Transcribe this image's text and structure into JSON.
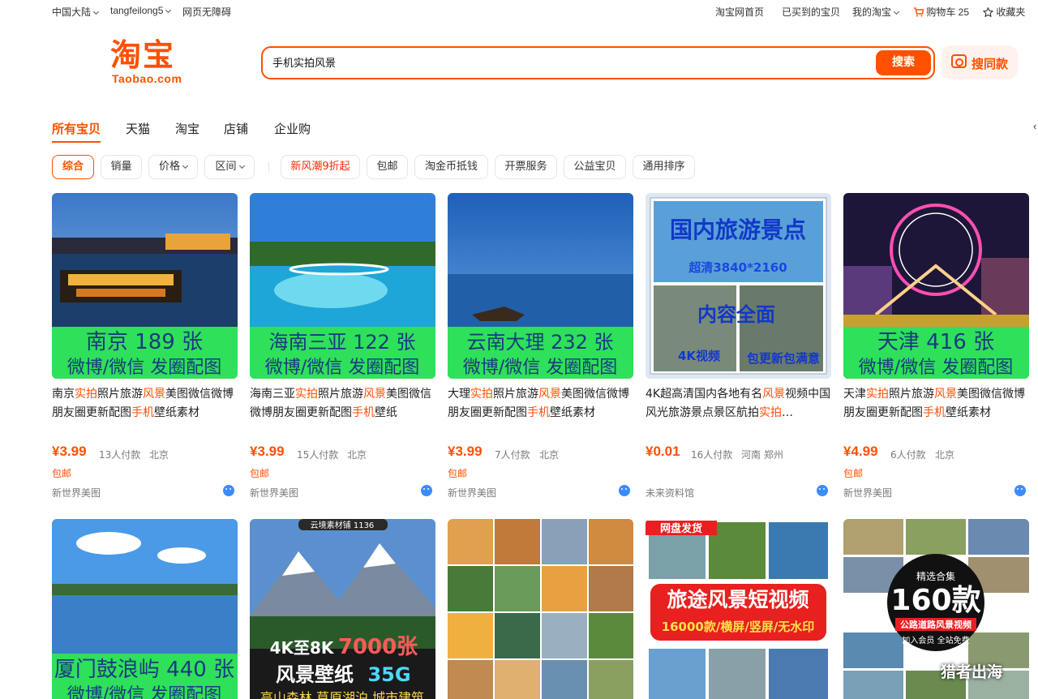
{
  "topbar": {
    "region": "中国大陆",
    "username": "tangfeilong5",
    "accessibility": "网页无障碍",
    "home": "淘宝网首页",
    "bought": "已买到的宝贝",
    "my_taobao": "我的淘宝",
    "cart": "购物车 25",
    "favorites": "收藏夹"
  },
  "logo": {
    "cn": "淘宝",
    "en": "Taobao.com"
  },
  "search": {
    "query": "手机实拍风景",
    "button": "搜索",
    "image_search": "搜同款"
  },
  "tabs": [
    "所有宝贝",
    "天猫",
    "淘宝",
    "店铺",
    "企业购"
  ],
  "filters": {
    "sort_default": "综合",
    "sales": "销量",
    "price": "价格",
    "range": "区间",
    "promo": "新风潮9折起",
    "free_shipping": "包邮",
    "coins": "淘金币抵钱",
    "invoice": "开票服务",
    "charity": "公益宝贝",
    "general_sort": "通用排序"
  },
  "products": [
    {
      "banner": [
        "南京 189 张",
        "微博/微信 发圈配图"
      ],
      "title_parts": [
        "南京",
        "实拍",
        "照片旅游",
        "风景",
        "美图微信微博朋友圈更新配图",
        "手机",
        "壁纸素材"
      ],
      "price": "¥3.99",
      "sales": "13人付款",
      "location": "北京",
      "shipping": "包邮",
      "shop": "新世界美图"
    },
    {
      "banner": [
        "海南三亚 122 张",
        "微博/微信 发圈配图"
      ],
      "title_parts": [
        "海南三亚",
        "实拍",
        "照片旅游",
        "风景",
        "美图微信微博朋友圈更新配图",
        "手机",
        "壁纸"
      ],
      "price": "¥3.99",
      "sales": "15人付款",
      "location": "北京",
      "shipping": "包邮",
      "shop": "新世界美图"
    },
    {
      "banner": [
        "云南大理 232 张",
        "微博/微信 发圈配图"
      ],
      "title_parts": [
        "大理",
        "实拍",
        "照片旅游",
        "风景",
        "美图微信微博朋友圈更新配图",
        "手机",
        "壁纸素材"
      ],
      "price": "¥3.99",
      "sales": "7人付款",
      "location": "北京",
      "shipping": "包邮",
      "shop": "新世界美图"
    },
    {
      "banner": [
        "国内旅游景点",
        "超清3840*2160",
        "内容全面",
        "4K视频",
        "包更新包满意"
      ],
      "title_parts": [
        "4K超高清国内各地有名",
        "风景",
        "视频中国风光旅游景点景区航拍",
        "实拍",
        "…",
        "",
        ""
      ],
      "price": "¥0.01",
      "sales": "16人付款",
      "location": "河南 郑州",
      "shipping": "",
      "shop": "未来资料馆"
    },
    {
      "banner": [
        "天津 416 张",
        "微博/微信 发圈配图"
      ],
      "title_parts": [
        "天津",
        "实拍",
        "照片旅游",
        "风景",
        "美图微信微博朋友圈更新配图",
        "手机",
        "壁纸素材"
      ],
      "price": "¥4.99",
      "sales": "6人付款",
      "location": "北京",
      "shipping": "包邮",
      "shop": "新世界美图"
    },
    {
      "banner": [
        "厦门鼓浪屿 440 张",
        "微博/微信 发圈配图"
      ]
    },
    {
      "banner": [
        "云境素材铺 1136",
        "4K至8K",
        "7000张",
        "风景壁纸",
        "35G",
        "高山森林 草原湖泊 城市建筑"
      ]
    },
    {
      "banner": []
    },
    {
      "banner": [
        "网盘发货",
        "旅途风景短视频",
        "16000款/横屏/竖屏/无水印"
      ]
    },
    {
      "banner": [
        "精选合集",
        "160款",
        "公路道路风景视频",
        "加入会员 全站免费"
      ]
    }
  ],
  "watermark": "猎者出海",
  "colors": {
    "accent": "#ff5000",
    "banner_green": "#2be05a",
    "price": "#ff5000"
  }
}
